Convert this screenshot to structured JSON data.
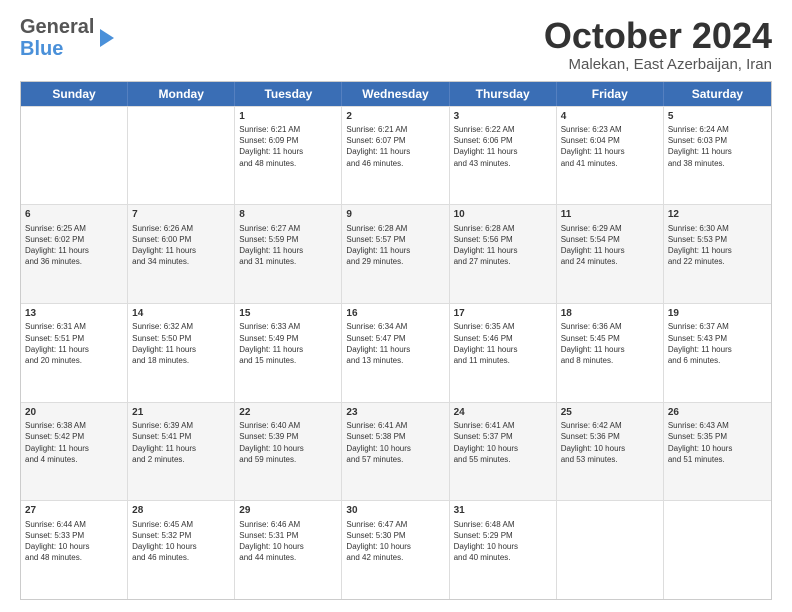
{
  "logo": {
    "line1": "General",
    "line2": "Blue"
  },
  "title": "October 2024",
  "location": "Malekan, East Azerbaijan, Iran",
  "days": [
    "Sunday",
    "Monday",
    "Tuesday",
    "Wednesday",
    "Thursday",
    "Friday",
    "Saturday"
  ],
  "weeks": [
    [
      {
        "day": "",
        "text": ""
      },
      {
        "day": "",
        "text": ""
      },
      {
        "day": "1",
        "text": "Sunrise: 6:21 AM\nSunset: 6:09 PM\nDaylight: 11 hours\nand 48 minutes."
      },
      {
        "day": "2",
        "text": "Sunrise: 6:21 AM\nSunset: 6:07 PM\nDaylight: 11 hours\nand 46 minutes."
      },
      {
        "day": "3",
        "text": "Sunrise: 6:22 AM\nSunset: 6:06 PM\nDaylight: 11 hours\nand 43 minutes."
      },
      {
        "day": "4",
        "text": "Sunrise: 6:23 AM\nSunset: 6:04 PM\nDaylight: 11 hours\nand 41 minutes."
      },
      {
        "day": "5",
        "text": "Sunrise: 6:24 AM\nSunset: 6:03 PM\nDaylight: 11 hours\nand 38 minutes."
      }
    ],
    [
      {
        "day": "6",
        "text": "Sunrise: 6:25 AM\nSunset: 6:02 PM\nDaylight: 11 hours\nand 36 minutes."
      },
      {
        "day": "7",
        "text": "Sunrise: 6:26 AM\nSunset: 6:00 PM\nDaylight: 11 hours\nand 34 minutes."
      },
      {
        "day": "8",
        "text": "Sunrise: 6:27 AM\nSunset: 5:59 PM\nDaylight: 11 hours\nand 31 minutes."
      },
      {
        "day": "9",
        "text": "Sunrise: 6:28 AM\nSunset: 5:57 PM\nDaylight: 11 hours\nand 29 minutes."
      },
      {
        "day": "10",
        "text": "Sunrise: 6:28 AM\nSunset: 5:56 PM\nDaylight: 11 hours\nand 27 minutes."
      },
      {
        "day": "11",
        "text": "Sunrise: 6:29 AM\nSunset: 5:54 PM\nDaylight: 11 hours\nand 24 minutes."
      },
      {
        "day": "12",
        "text": "Sunrise: 6:30 AM\nSunset: 5:53 PM\nDaylight: 11 hours\nand 22 minutes."
      }
    ],
    [
      {
        "day": "13",
        "text": "Sunrise: 6:31 AM\nSunset: 5:51 PM\nDaylight: 11 hours\nand 20 minutes."
      },
      {
        "day": "14",
        "text": "Sunrise: 6:32 AM\nSunset: 5:50 PM\nDaylight: 11 hours\nand 18 minutes."
      },
      {
        "day": "15",
        "text": "Sunrise: 6:33 AM\nSunset: 5:49 PM\nDaylight: 11 hours\nand 15 minutes."
      },
      {
        "day": "16",
        "text": "Sunrise: 6:34 AM\nSunset: 5:47 PM\nDaylight: 11 hours\nand 13 minutes."
      },
      {
        "day": "17",
        "text": "Sunrise: 6:35 AM\nSunset: 5:46 PM\nDaylight: 11 hours\nand 11 minutes."
      },
      {
        "day": "18",
        "text": "Sunrise: 6:36 AM\nSunset: 5:45 PM\nDaylight: 11 hours\nand 8 minutes."
      },
      {
        "day": "19",
        "text": "Sunrise: 6:37 AM\nSunset: 5:43 PM\nDaylight: 11 hours\nand 6 minutes."
      }
    ],
    [
      {
        "day": "20",
        "text": "Sunrise: 6:38 AM\nSunset: 5:42 PM\nDaylight: 11 hours\nand 4 minutes."
      },
      {
        "day": "21",
        "text": "Sunrise: 6:39 AM\nSunset: 5:41 PM\nDaylight: 11 hours\nand 2 minutes."
      },
      {
        "day": "22",
        "text": "Sunrise: 6:40 AM\nSunset: 5:39 PM\nDaylight: 10 hours\nand 59 minutes."
      },
      {
        "day": "23",
        "text": "Sunrise: 6:41 AM\nSunset: 5:38 PM\nDaylight: 10 hours\nand 57 minutes."
      },
      {
        "day": "24",
        "text": "Sunrise: 6:41 AM\nSunset: 5:37 PM\nDaylight: 10 hours\nand 55 minutes."
      },
      {
        "day": "25",
        "text": "Sunrise: 6:42 AM\nSunset: 5:36 PM\nDaylight: 10 hours\nand 53 minutes."
      },
      {
        "day": "26",
        "text": "Sunrise: 6:43 AM\nSunset: 5:35 PM\nDaylight: 10 hours\nand 51 minutes."
      }
    ],
    [
      {
        "day": "27",
        "text": "Sunrise: 6:44 AM\nSunset: 5:33 PM\nDaylight: 10 hours\nand 48 minutes."
      },
      {
        "day": "28",
        "text": "Sunrise: 6:45 AM\nSunset: 5:32 PM\nDaylight: 10 hours\nand 46 minutes."
      },
      {
        "day": "29",
        "text": "Sunrise: 6:46 AM\nSunset: 5:31 PM\nDaylight: 10 hours\nand 44 minutes."
      },
      {
        "day": "30",
        "text": "Sunrise: 6:47 AM\nSunset: 5:30 PM\nDaylight: 10 hours\nand 42 minutes."
      },
      {
        "day": "31",
        "text": "Sunrise: 6:48 AM\nSunset: 5:29 PM\nDaylight: 10 hours\nand 40 minutes."
      },
      {
        "day": "",
        "text": ""
      },
      {
        "day": "",
        "text": ""
      }
    ]
  ]
}
